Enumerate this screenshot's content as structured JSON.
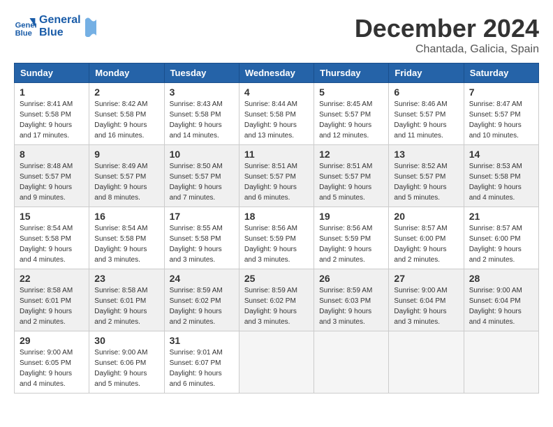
{
  "logo": {
    "line1": "General",
    "line2": "Blue"
  },
  "title": "December 2024",
  "subtitle": "Chantada, Galicia, Spain",
  "days_of_week": [
    "Sunday",
    "Monday",
    "Tuesday",
    "Wednesday",
    "Thursday",
    "Friday",
    "Saturday"
  ],
  "weeks": [
    [
      {
        "num": "1",
        "info": "Sunrise: 8:41 AM\nSunset: 5:58 PM\nDaylight: 9 hours\nand 17 minutes.",
        "shaded": false
      },
      {
        "num": "2",
        "info": "Sunrise: 8:42 AM\nSunset: 5:58 PM\nDaylight: 9 hours\nand 16 minutes.",
        "shaded": false
      },
      {
        "num": "3",
        "info": "Sunrise: 8:43 AM\nSunset: 5:58 PM\nDaylight: 9 hours\nand 14 minutes.",
        "shaded": false
      },
      {
        "num": "4",
        "info": "Sunrise: 8:44 AM\nSunset: 5:58 PM\nDaylight: 9 hours\nand 13 minutes.",
        "shaded": false
      },
      {
        "num": "5",
        "info": "Sunrise: 8:45 AM\nSunset: 5:57 PM\nDaylight: 9 hours\nand 12 minutes.",
        "shaded": false
      },
      {
        "num": "6",
        "info": "Sunrise: 8:46 AM\nSunset: 5:57 PM\nDaylight: 9 hours\nand 11 minutes.",
        "shaded": false
      },
      {
        "num": "7",
        "info": "Sunrise: 8:47 AM\nSunset: 5:57 PM\nDaylight: 9 hours\nand 10 minutes.",
        "shaded": false
      }
    ],
    [
      {
        "num": "8",
        "info": "Sunrise: 8:48 AM\nSunset: 5:57 PM\nDaylight: 9 hours\nand 9 minutes.",
        "shaded": true
      },
      {
        "num": "9",
        "info": "Sunrise: 8:49 AM\nSunset: 5:57 PM\nDaylight: 9 hours\nand 8 minutes.",
        "shaded": true
      },
      {
        "num": "10",
        "info": "Sunrise: 8:50 AM\nSunset: 5:57 PM\nDaylight: 9 hours\nand 7 minutes.",
        "shaded": true
      },
      {
        "num": "11",
        "info": "Sunrise: 8:51 AM\nSunset: 5:57 PM\nDaylight: 9 hours\nand 6 minutes.",
        "shaded": true
      },
      {
        "num": "12",
        "info": "Sunrise: 8:51 AM\nSunset: 5:57 PM\nDaylight: 9 hours\nand 5 minutes.",
        "shaded": true
      },
      {
        "num": "13",
        "info": "Sunrise: 8:52 AM\nSunset: 5:57 PM\nDaylight: 9 hours\nand 5 minutes.",
        "shaded": true
      },
      {
        "num": "14",
        "info": "Sunrise: 8:53 AM\nSunset: 5:58 PM\nDaylight: 9 hours\nand 4 minutes.",
        "shaded": true
      }
    ],
    [
      {
        "num": "15",
        "info": "Sunrise: 8:54 AM\nSunset: 5:58 PM\nDaylight: 9 hours\nand 4 minutes.",
        "shaded": false
      },
      {
        "num": "16",
        "info": "Sunrise: 8:54 AM\nSunset: 5:58 PM\nDaylight: 9 hours\nand 3 minutes.",
        "shaded": false
      },
      {
        "num": "17",
        "info": "Sunrise: 8:55 AM\nSunset: 5:58 PM\nDaylight: 9 hours\nand 3 minutes.",
        "shaded": false
      },
      {
        "num": "18",
        "info": "Sunrise: 8:56 AM\nSunset: 5:59 PM\nDaylight: 9 hours\nand 3 minutes.",
        "shaded": false
      },
      {
        "num": "19",
        "info": "Sunrise: 8:56 AM\nSunset: 5:59 PM\nDaylight: 9 hours\nand 2 minutes.",
        "shaded": false
      },
      {
        "num": "20",
        "info": "Sunrise: 8:57 AM\nSunset: 6:00 PM\nDaylight: 9 hours\nand 2 minutes.",
        "shaded": false
      },
      {
        "num": "21",
        "info": "Sunrise: 8:57 AM\nSunset: 6:00 PM\nDaylight: 9 hours\nand 2 minutes.",
        "shaded": false
      }
    ],
    [
      {
        "num": "22",
        "info": "Sunrise: 8:58 AM\nSunset: 6:01 PM\nDaylight: 9 hours\nand 2 minutes.",
        "shaded": true
      },
      {
        "num": "23",
        "info": "Sunrise: 8:58 AM\nSunset: 6:01 PM\nDaylight: 9 hours\nand 2 minutes.",
        "shaded": true
      },
      {
        "num": "24",
        "info": "Sunrise: 8:59 AM\nSunset: 6:02 PM\nDaylight: 9 hours\nand 2 minutes.",
        "shaded": true
      },
      {
        "num": "25",
        "info": "Sunrise: 8:59 AM\nSunset: 6:02 PM\nDaylight: 9 hours\nand 3 minutes.",
        "shaded": true
      },
      {
        "num": "26",
        "info": "Sunrise: 8:59 AM\nSunset: 6:03 PM\nDaylight: 9 hours\nand 3 minutes.",
        "shaded": true
      },
      {
        "num": "27",
        "info": "Sunrise: 9:00 AM\nSunset: 6:04 PM\nDaylight: 9 hours\nand 3 minutes.",
        "shaded": true
      },
      {
        "num": "28",
        "info": "Sunrise: 9:00 AM\nSunset: 6:04 PM\nDaylight: 9 hours\nand 4 minutes.",
        "shaded": true
      }
    ],
    [
      {
        "num": "29",
        "info": "Sunrise: 9:00 AM\nSunset: 6:05 PM\nDaylight: 9 hours\nand 4 minutes.",
        "shaded": false
      },
      {
        "num": "30",
        "info": "Sunrise: 9:00 AM\nSunset: 6:06 PM\nDaylight: 9 hours\nand 5 minutes.",
        "shaded": false
      },
      {
        "num": "31",
        "info": "Sunrise: 9:01 AM\nSunset: 6:07 PM\nDaylight: 9 hours\nand 6 minutes.",
        "shaded": false
      },
      null,
      null,
      null,
      null
    ]
  ]
}
